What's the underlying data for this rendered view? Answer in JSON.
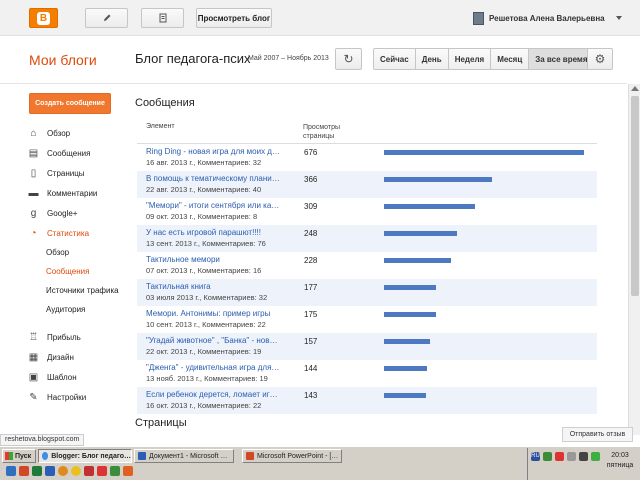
{
  "topbar": {
    "view_blog_label": "Просмотреть блог",
    "user_name": "Решетова Алена Валерьевна"
  },
  "header": {
    "my_blogs": "Мои блоги",
    "blog_name": "Блог педагога-псих",
    "date_range": "Май 2007 – Ноябрь 2013",
    "ranges": [
      "Сейчас",
      "День",
      "Неделя",
      "Месяц",
      "За все время"
    ],
    "active_range": "За все время"
  },
  "sidebar": {
    "create_label": "Создать сообщение",
    "items": [
      {
        "label": "Обзор",
        "icon": "home-icon"
      },
      {
        "label": "Сообщения",
        "icon": "posts-icon"
      },
      {
        "label": "Страницы",
        "icon": "pages-icon"
      },
      {
        "label": "Комментарии",
        "icon": "comments-icon"
      },
      {
        "label": "Google+",
        "icon": "google-plus-icon"
      },
      {
        "label": "Статистика",
        "icon": "stats-icon"
      }
    ],
    "sub_items": [
      "Обзор",
      "Сообщения",
      "Источники трафика",
      "Аудитория"
    ],
    "items2": [
      {
        "label": "Прибыль",
        "icon": "trophy-icon"
      },
      {
        "label": "Дизайн",
        "icon": "layout-icon"
      },
      {
        "label": "Шаблон",
        "icon": "template-icon"
      },
      {
        "label": "Настройки",
        "icon": "wrench-icon"
      }
    ]
  },
  "main": {
    "section_title": "Сообщения",
    "col_element": "Элемент",
    "col_views_1": "Просмотры",
    "col_views_2": "страницы",
    "rows": [
      {
        "title": "Ring Ding - новая игра для моих д…",
        "meta": "16 авг. 2013 г., Комментариев: 32",
        "views": 676
      },
      {
        "title": "В помощь к тематическому плани…",
        "meta": "22 авг. 2013 г., Комментариев: 40",
        "views": 366
      },
      {
        "title": "\"Мемори\" - итоги сентября или ка…",
        "meta": "09 окт. 2013 г., Комментариев: 8",
        "views": 309
      },
      {
        "title": "У нас есть игровой парашют!!!!",
        "meta": "13 сент. 2013 г., Комментариев: 76",
        "views": 248
      },
      {
        "title": "Тактильное мемори",
        "meta": "07 окт. 2013 г., Комментариев: 16",
        "views": 228
      },
      {
        "title": "Тактильная книга",
        "meta": "03 июля 2013 г., Комментариев: 32",
        "views": 177
      },
      {
        "title": "Мемори. Антонимы: пример игры",
        "meta": "10 сент. 2013 г., Комментариев: 22",
        "views": 175
      },
      {
        "title": "\"Угадай животное\" , \"Банка\" - нов…",
        "meta": "22 окт. 2013 г., Комментариев: 19",
        "views": 157
      },
      {
        "title": "\"Дженга\" - удивительная игра для…",
        "meta": "13 нояб. 2013 г., Комментариев: 19",
        "views": 144
      },
      {
        "title": "Если ребенок дерется, ломает иг…",
        "meta": "16 окт. 2013 г., Комментариев: 22",
        "views": 143
      }
    ],
    "max_views": 676,
    "section2_title": "Страницы"
  },
  "status": {
    "url": "reshetova.blogspot.com",
    "send_review": "Отправить отзыв"
  },
  "taskbar": {
    "start_label": "Пуск",
    "tasks": [
      "Blogger: Блог педаго…",
      "Документ1 - Microsoft …",
      "Microsoft PowerPoint - […"
    ],
    "time": "20:03",
    "day": "пятница",
    "lang": "RU"
  }
}
